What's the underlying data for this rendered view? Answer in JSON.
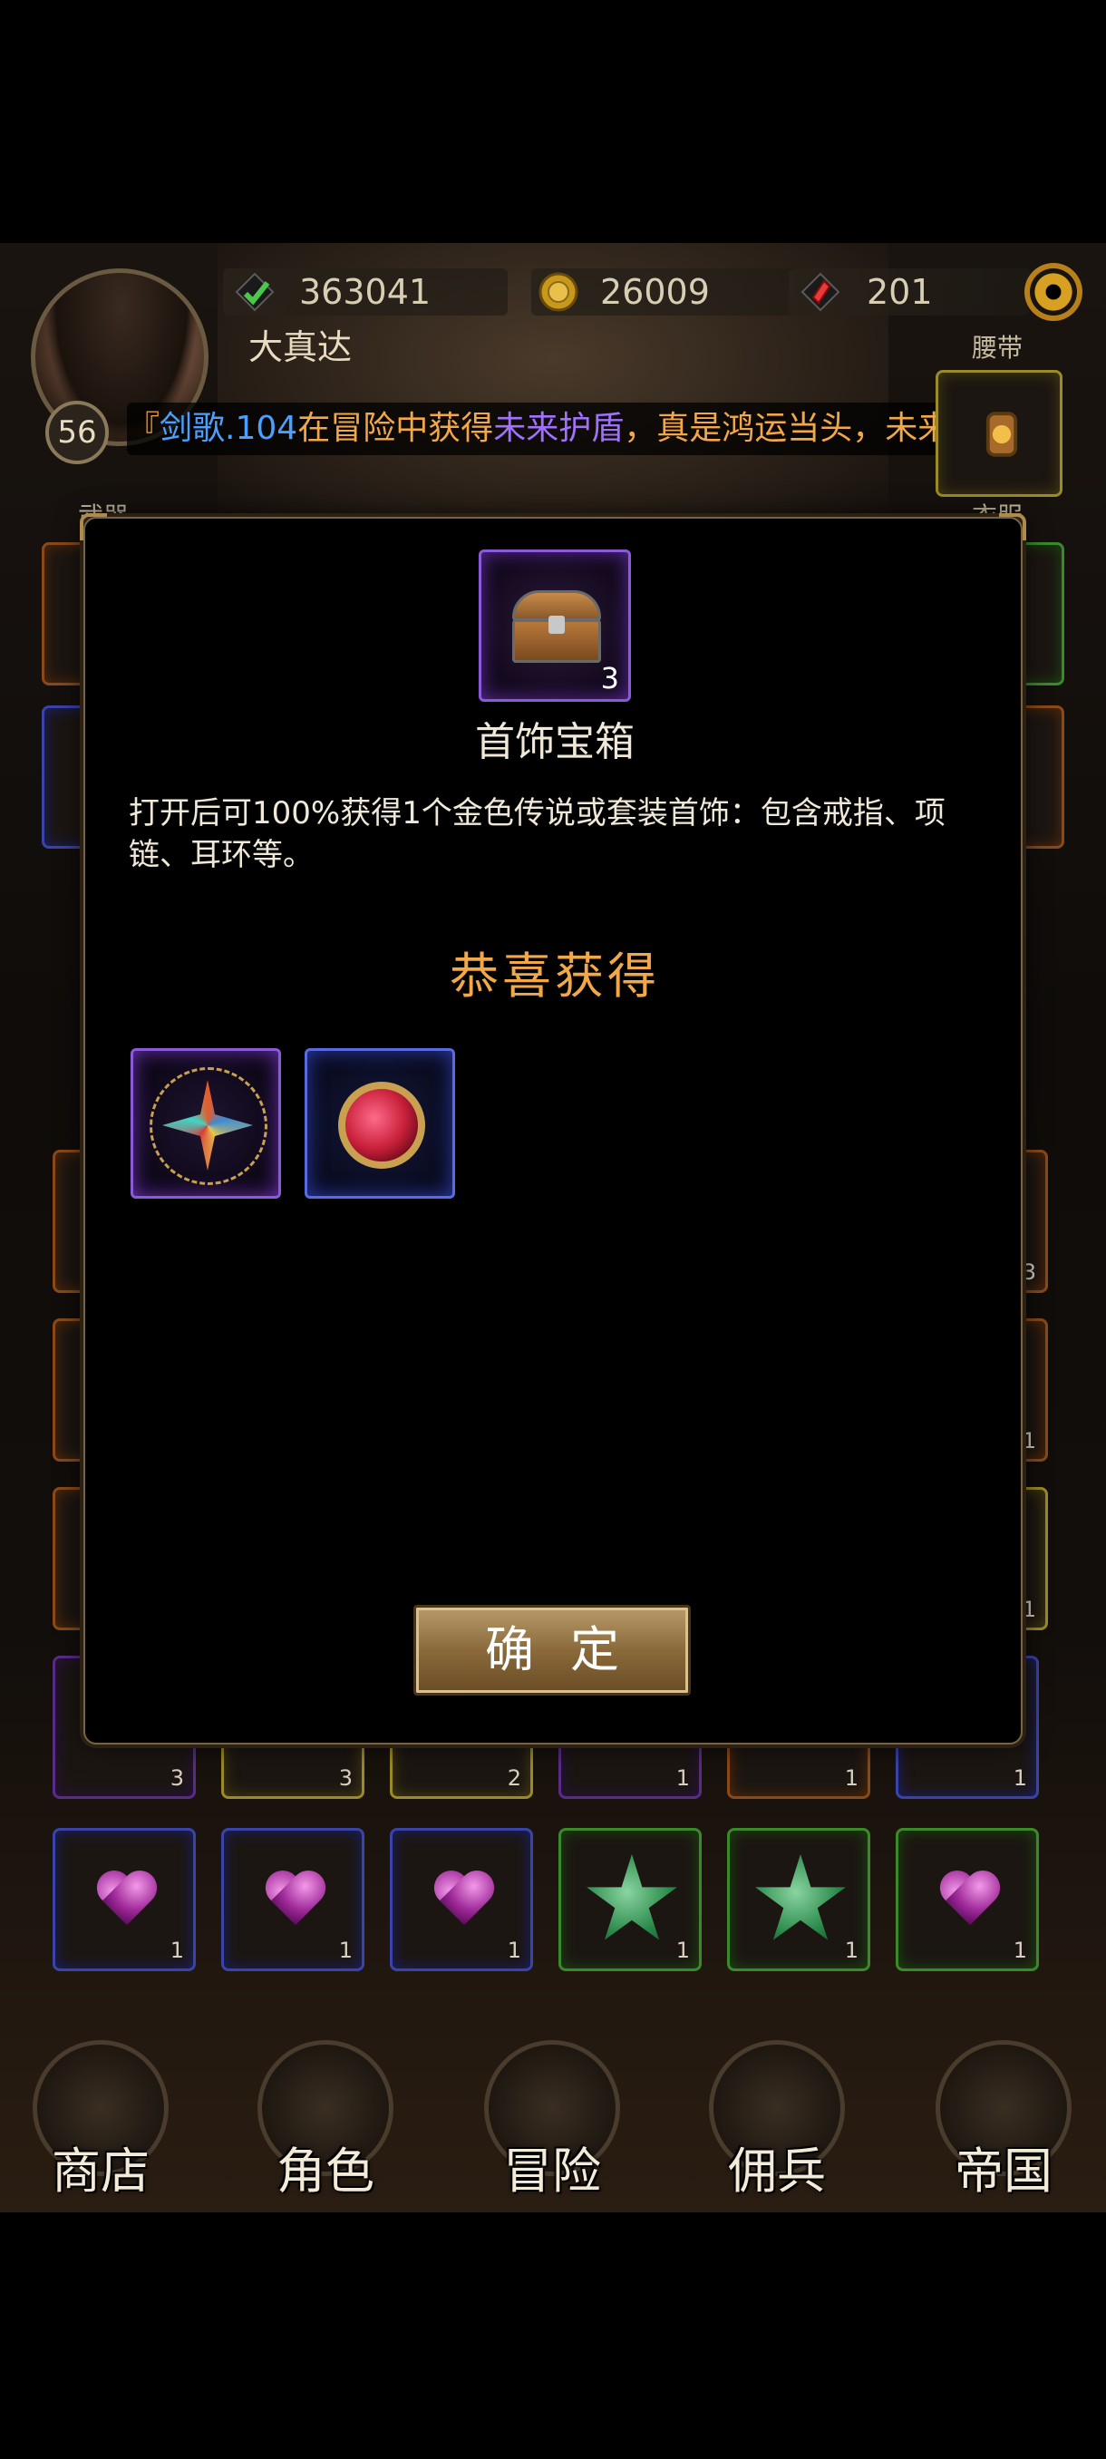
{
  "player": {
    "name": "大真达",
    "level": "56",
    "power": "363041",
    "gold": "26009",
    "gems": "201"
  },
  "ticker": {
    "prefix": "『",
    "player": "剑歌.104",
    "text1": "在冒险中获得",
    "item": "未来护盾",
    "text2": "，真是鸿运当头，未来"
  },
  "equipment_labels": {
    "belt": "腰带",
    "weapon": "武器",
    "clothes": "衣服"
  },
  "modal": {
    "item_name": "首饰宝箱",
    "item_count": "3",
    "description": "打开后可100%获得1个金色传说或套装首饰：包含戒指、项链、耳环等。",
    "congrats": "恭喜获得",
    "rewards": [
      "necklace-star-icon",
      "ruby-amulet-icon"
    ],
    "confirm": "确定"
  },
  "inventory": {
    "row_hidden_counts": [
      "3",
      "3",
      "2",
      "1",
      "1",
      "1"
    ],
    "row_visible": [
      {
        "icon": "purple-heart-gem-icon",
        "count": "1"
      },
      {
        "icon": "purple-heart-gem-icon",
        "count": "1"
      },
      {
        "icon": "purple-heart-gem-icon",
        "count": "1"
      },
      {
        "icon": "green-star-gem-icon",
        "count": "1"
      },
      {
        "icon": "green-star-gem-icon",
        "count": "1"
      },
      {
        "icon": "purple-heart-gem-icon",
        "count": "1"
      }
    ],
    "right_counts": [
      "3",
      "1",
      "1"
    ]
  },
  "nav": {
    "shop": "商店",
    "character": "角色",
    "adventure": "冒险",
    "mercenary": "佣兵",
    "empire": "帝国"
  },
  "colors": {
    "ticker_player": "#4aa0ff",
    "ticker_text": "#f2a848",
    "ticker_item": "#a070ff",
    "congrats": "#f2a848"
  }
}
